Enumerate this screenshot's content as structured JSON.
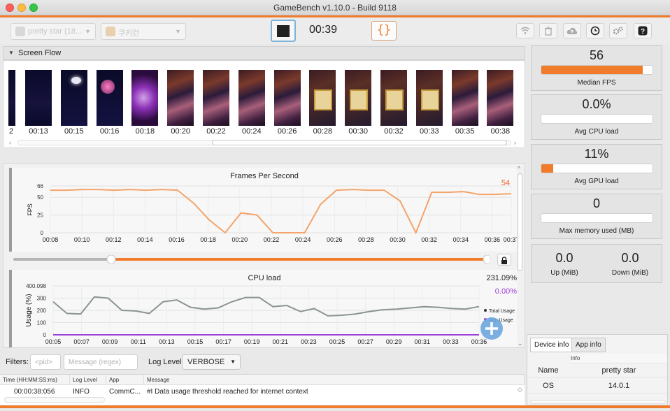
{
  "window": {
    "title": "GameBench v1.10.0 - Build 9118",
    "accent_color": "#f07b2b"
  },
  "toolbar": {
    "device_select": "pretty star (18...",
    "app_select": "쿠키런",
    "timer": "00:39",
    "json_label": "{}",
    "icons": [
      "wifi-icon",
      "trash-icon",
      "cloud-upload-icon",
      "clock-icon",
      "settings-icon",
      "help-icon"
    ]
  },
  "screen_flow": {
    "title": "Screen Flow",
    "frames": [
      {
        "time": "2",
        "kind": "dark"
      },
      {
        "time": "00:13",
        "kind": "dark"
      },
      {
        "time": "00:15",
        "kind": "glow"
      },
      {
        "time": "00:16",
        "kind": "pinkorb"
      },
      {
        "time": "00:18",
        "kind": "purple"
      },
      {
        "time": "00:20",
        "kind": "game"
      },
      {
        "time": "00:22",
        "kind": "game"
      },
      {
        "time": "00:24",
        "kind": "game"
      },
      {
        "time": "00:26",
        "kind": "game"
      },
      {
        "time": "00:28",
        "kind": "menu"
      },
      {
        "time": "00:30",
        "kind": "menu"
      },
      {
        "time": "00:32",
        "kind": "menu"
      },
      {
        "time": "00:33",
        "kind": "menu"
      },
      {
        "time": "00:35",
        "kind": "game"
      },
      {
        "time": "00:38",
        "kind": "game"
      }
    ]
  },
  "fps_chart": {
    "title": "Frames Per Second",
    "ylabel": "FPS",
    "current_value": "54",
    "line_color": "#f4a46a",
    "y_ticks": [
      "66",
      "50",
      "25",
      "0"
    ],
    "x_ticks": [
      "00:08",
      "00:10",
      "00:12",
      "00:14",
      "00:16",
      "00:18",
      "00:20",
      "00:22",
      "00:24",
      "00:26",
      "00:28",
      "00:30",
      "00:32",
      "00:34",
      "00:36",
      "00:37"
    ]
  },
  "cpu_chart": {
    "title": "CPU load",
    "ylabel": "Usage (%)",
    "total_value": "231.09%",
    "app_value": "0.00%",
    "total_color": "#8a958d",
    "app_color": "#9b3fd6",
    "y_ticks": [
      "400.098",
      "300",
      "200",
      "100",
      "0"
    ],
    "x_ticks": [
      "00:05",
      "00:07",
      "00:09",
      "00:11",
      "00:13",
      "00:15",
      "00:17",
      "00:19",
      "00:21",
      "00:23",
      "00:25",
      "00:27",
      "00:29",
      "00:31",
      "00:33",
      "00:36"
    ],
    "legend": [
      "Total Usage",
      "App Usage"
    ]
  },
  "chart_data": [
    {
      "type": "line",
      "title": "Frames Per Second",
      "xlabel": "",
      "ylabel": "FPS",
      "ylim": [
        0,
        66
      ],
      "x": [
        "00:08",
        "00:09",
        "00:10",
        "00:11",
        "00:12",
        "00:13",
        "00:14",
        "00:15",
        "00:16",
        "00:17",
        "00:18",
        "00:19",
        "00:20",
        "00:21",
        "00:22",
        "00:23",
        "00:24",
        "00:25",
        "00:26",
        "00:27",
        "00:28",
        "00:29",
        "00:30",
        "00:31",
        "00:32",
        "00:33",
        "00:34",
        "00:35",
        "00:36",
        "00:37"
      ],
      "series": [
        {
          "values": [
            60,
            60,
            61,
            61,
            60,
            61,
            60,
            61,
            60,
            42,
            18,
            0,
            28,
            25,
            0,
            0,
            0,
            40,
            60,
            61,
            60,
            60,
            45,
            0,
            57,
            57,
            58,
            54,
            54,
            55
          ]
        }
      ]
    },
    {
      "type": "line",
      "title": "CPU load",
      "xlabel": "",
      "ylabel": "Usage (%)",
      "ylim": [
        0,
        400.098
      ],
      "x": [
        "00:05",
        "00:06",
        "00:07",
        "00:08",
        "00:09",
        "00:10",
        "00:11",
        "00:12",
        "00:13",
        "00:14",
        "00:15",
        "00:16",
        "00:17",
        "00:18",
        "00:19",
        "00:20",
        "00:21",
        "00:22",
        "00:23",
        "00:24",
        "00:25",
        "00:26",
        "00:27",
        "00:28",
        "00:29",
        "00:30",
        "00:31",
        "00:32",
        "00:33",
        "00:34",
        "00:35",
        "00:36"
      ],
      "series": [
        {
          "name": "Total Usage",
          "values": [
            270,
            175,
            170,
            310,
            300,
            200,
            195,
            175,
            270,
            285,
            225,
            210,
            220,
            270,
            305,
            305,
            230,
            240,
            190,
            215,
            155,
            160,
            170,
            190,
            205,
            210,
            220,
            230,
            225,
            215,
            210,
            231.09
          ]
        },
        {
          "name": "App Usage",
          "values": [
            0,
            0,
            0,
            0,
            0,
            0,
            0,
            0,
            0,
            0,
            0,
            0,
            0,
            0,
            0,
            0,
            0,
            0,
            0,
            0,
            0,
            0,
            0,
            0,
            0,
            0,
            0,
            0,
            0,
            0,
            0,
            0
          ]
        }
      ]
    }
  ],
  "stats": {
    "median_fps": {
      "value": "56",
      "label": "Median FPS",
      "fill": 0.91
    },
    "avg_cpu": {
      "value": "0.0%",
      "label": "Avg CPU load",
      "fill": 0.0
    },
    "avg_gpu": {
      "value": "11%",
      "label": "Avg GPU load",
      "fill": 0.11
    },
    "max_memory": {
      "value": "0",
      "label": "Max memory used (MB)",
      "fill": 0.0
    },
    "network": {
      "up_value": "0.0",
      "up_label": "Up (MiB)",
      "down_value": "0.0",
      "down_label": "Down (MiB)"
    }
  },
  "device_info": {
    "tabs": [
      "Device info",
      "App info"
    ],
    "header": "Info",
    "rows": [
      {
        "key": "Name",
        "value": "pretty star"
      },
      {
        "key": "OS",
        "value": "14.0.1"
      }
    ]
  },
  "log": {
    "filters_label": "Filters:",
    "pid_placeholder": "<pid>",
    "message_placeholder": "Message (regex)",
    "log_level_label": "Log Level:",
    "log_level_value": "VERBOSE",
    "columns": [
      "Time (HH:MM:SS:ms)",
      "Log Level",
      "App",
      "Message"
    ],
    "rows": [
      {
        "time": "00:00:38:056",
        "level": "INFO",
        "app": "CommC...",
        "message": "#I Data usage threshold reached for internet context"
      }
    ]
  }
}
